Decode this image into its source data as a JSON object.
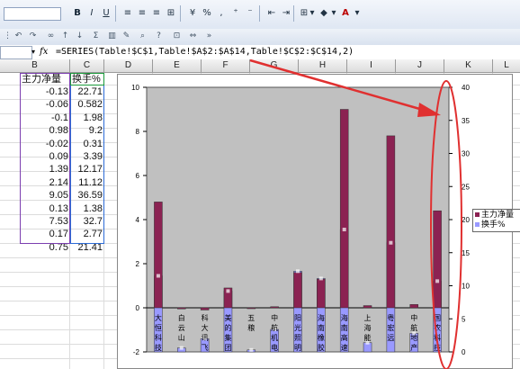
{
  "toolbar": {
    "font_size_box": "",
    "bold": "B",
    "italic": "I",
    "underline": "U",
    "percent": "%",
    "dropdown_arrow": "▾",
    "font_color_letter": "A"
  },
  "formula_bar": {
    "name_box": "",
    "fx": "fx",
    "formula": "=SERIES(Table!$C$1,Table!$A$2:$A$14,Table!$C$2:$C$14,2)"
  },
  "columns": [
    "B",
    "C",
    "D",
    "E",
    "F",
    "G",
    "H",
    "I",
    "J",
    "K",
    "L"
  ],
  "table": {
    "headers": [
      "主力净量",
      "换手%"
    ],
    "rows": [
      [
        "-0.13",
        "22.71"
      ],
      [
        "-0.06",
        "0.582"
      ],
      [
        "-0.1",
        "1.98"
      ],
      [
        "0.98",
        "9.2"
      ],
      [
        "-0.02",
        "0.31"
      ],
      [
        "0.09",
        "3.39"
      ],
      [
        "1.39",
        "12.17"
      ],
      [
        "2.14",
        "11.12"
      ],
      [
        "9.05",
        "36.59"
      ],
      [
        "0.13",
        "1.38"
      ],
      [
        "7.53",
        "32.7"
      ],
      [
        "0.17",
        "2.77"
      ],
      [
        "0.75",
        "21.41"
      ]
    ]
  },
  "chart_data": {
    "type": "bar",
    "title": "",
    "series": [
      {
        "name": "主力净量",
        "values": [
          4.8,
          -0.05,
          -0.1,
          0.9,
          -0.02,
          0.05,
          1.6,
          1.3,
          9.0,
          0.1,
          7.8,
          0.15,
          4.4
        ]
      },
      {
        "name": "换手%",
        "values": [
          11.5,
          0.6,
          2.0,
          9.2,
          0.3,
          3.4,
          12.2,
          11.1,
          18.5,
          1.4,
          16.5,
          2.8,
          10.7
        ]
      }
    ],
    "series_colors": [
      "#8b2252",
      "#9999ff"
    ],
    "y_left": {
      "min": -2,
      "max": 10,
      "ticks": [
        "-2",
        "0",
        "2",
        "4",
        "6",
        "8",
        "10"
      ]
    },
    "y_right": {
      "min": 0,
      "max": 40,
      "ticks": [
        "0",
        "5",
        "10",
        "15",
        "20",
        "25",
        "30",
        "35",
        "40"
      ]
    },
    "category_labels": [
      "大恒科技",
      "白云山",
      "科大讯飞",
      "美的集团",
      "五粮",
      "中航机电",
      "阳光照明",
      "海南橡胶",
      "海南高速",
      "上海能",
      "粤宏远",
      "中航地产",
      "国农科技"
    ],
    "legend": [
      "主力净量",
      "换手%"
    ],
    "legend_position": "right",
    "grid": false,
    "plot_background": "#c0c0c0"
  }
}
